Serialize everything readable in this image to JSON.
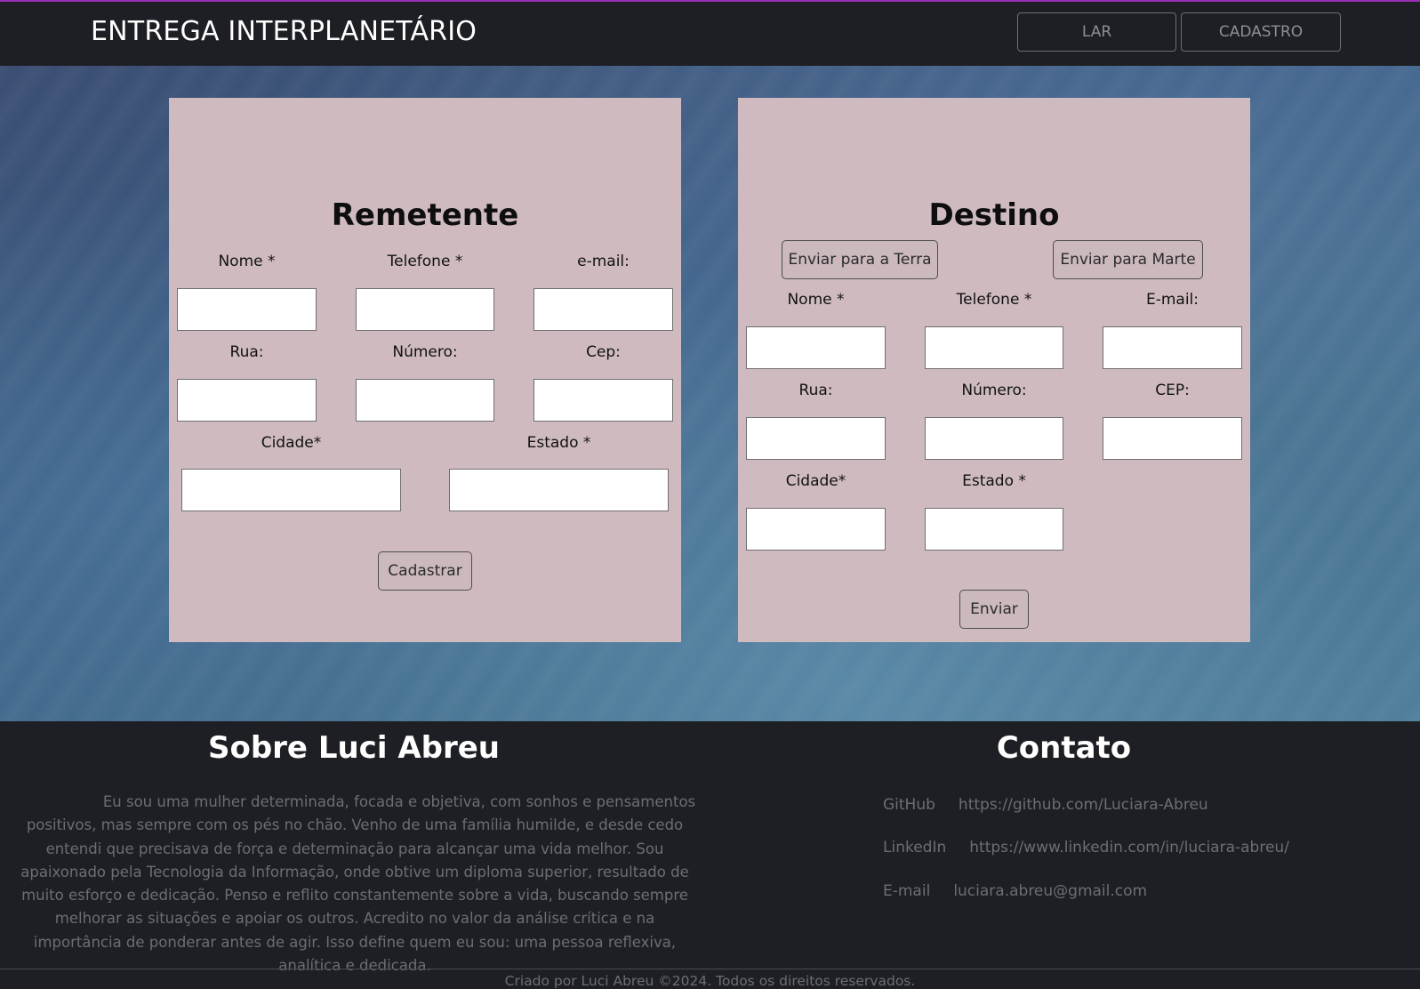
{
  "header": {
    "brand": "ENTREGA INTERPLANETÁRIO",
    "nav": {
      "home": "LAR",
      "register": "CADASTRO"
    }
  },
  "sender": {
    "title": "Remetente",
    "labels": {
      "name": "Nome *",
      "phone": "Telefone *",
      "email": "e-mail:",
      "street": "Rua:",
      "number": "Número:",
      "zip": "Cep:",
      "city": "Cidade*",
      "state": "Estado *"
    },
    "submit": "Cadastrar"
  },
  "destination": {
    "title": "Destino",
    "earth_button": "Enviar para a Terra",
    "mars_button": "Enviar para Marte",
    "labels": {
      "name": "Nome *",
      "phone": "Telefone *",
      "email": "E-mail:",
      "street": "Rua:",
      "number": "Número:",
      "zip": "CEP:",
      "city": "Cidade*",
      "state": "Estado *"
    },
    "submit": "Enviar"
  },
  "footer": {
    "about_title": "Sobre Luci Abreu",
    "about_text": "Eu sou uma mulher determinada, focada e objetiva, com sonhos e pensamentos positivos, mas sempre com os pés no chão. Venho de uma família humilde, e desde cedo entendi que precisava de força e determinação para alcançar uma vida melhor. Sou apaixonado pela Tecnologia da Informação, onde obtive um diploma superior, resultado de muito esforço e dedicação. Penso e reflito constantemente sobre a vida, buscando sempre melhorar as situações e apoiar os outros. Acredito no valor da análise crítica e na importância de ponderar antes de agir. Isso define quem eu sou: uma pessoa reflexiva, analítica e dedicada.",
    "contact_title": "Contato",
    "contacts": [
      {
        "label": "GitHub",
        "value": "https://github.com/Luciara-Abreu"
      },
      {
        "label": "LinkedIn",
        "value": "https://www.linkedin.com/in/luciara-abreu/"
      },
      {
        "label": "E-mail",
        "value": "luciara.abreu@gmail.com"
      }
    ],
    "copyright": "Criado por Luci Abreu ©2024. Todos os direitos reservados."
  },
  "colors": {
    "accent_line": "#9a2fb5",
    "panel": "#cfbbbf",
    "header_bg": "#1e1f24"
  }
}
